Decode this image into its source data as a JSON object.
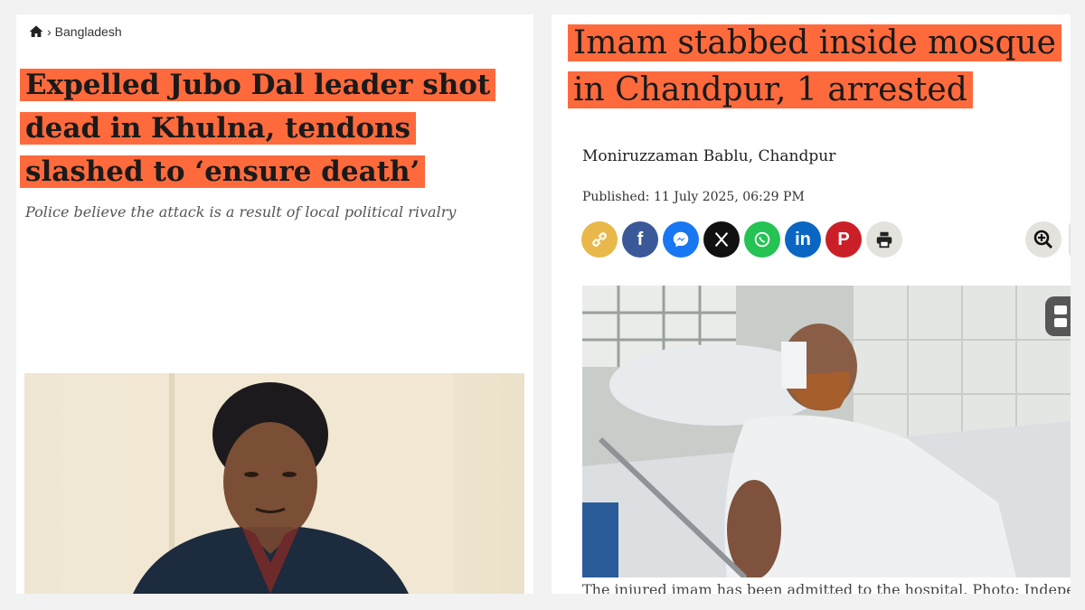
{
  "left_article": {
    "breadcrumb": {
      "icon": "home-icon",
      "section": "Bangladesh"
    },
    "title": "Expelled Jubo Dal leader shot dead in Khulna, tendons slashed to ‘ensure death’",
    "subtitle": "Police believe the attack is a result of local political rivalry",
    "highlight_color": "#ff6a3d"
  },
  "right_article": {
    "title": "Imam stabbed inside mosque in Chandpur, 1 arrested",
    "author": "Moniruzzaman Bablu, Chandpur",
    "published": "Published: 11 July 2025, 06:29 PM",
    "share_buttons": [
      {
        "name": "copy-link",
        "icon": "link-icon",
        "color": "#e8b84a"
      },
      {
        "name": "facebook",
        "icon": "facebook-icon",
        "color": "#3b5998"
      },
      {
        "name": "messenger",
        "icon": "messenger-icon",
        "color": "#1877f2"
      },
      {
        "name": "x",
        "icon": "x-icon",
        "color": "#111111"
      },
      {
        "name": "whatsapp",
        "icon": "whatsapp-icon",
        "color": "#25c254"
      },
      {
        "name": "linkedin",
        "icon": "linkedin-icon",
        "color": "#0a66c2"
      },
      {
        "name": "pinterest",
        "icon": "pinterest-icon",
        "color": "#cb1f27"
      },
      {
        "name": "print",
        "icon": "print-icon",
        "color": "#e4e2dc"
      }
    ],
    "zoom_icon": "zoom-in-icon",
    "caption": "The injured imam has been admitted to the hospital. Photo: Independent",
    "highlight_color": "#ff6a3d"
  }
}
